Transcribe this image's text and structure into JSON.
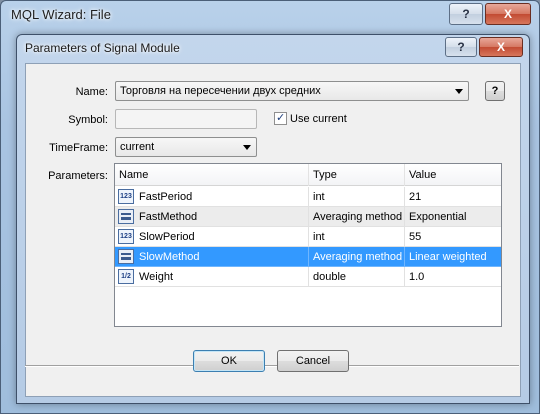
{
  "outer_window": {
    "title": "MQL Wizard: File",
    "help_label": "?",
    "close_label": "X"
  },
  "dialog": {
    "title": "Parameters of Signal Module",
    "help_label": "?",
    "close_label": "X",
    "name_label": "Name:",
    "name_value": "Торговля на пересечении двух средних",
    "name_help": "?",
    "symbol_label": "Symbol:",
    "symbol_value": "",
    "use_current_label": "Use current",
    "use_current_checked": true,
    "timeframe_label": "TimeFrame:",
    "timeframe_value": "current",
    "parameters_label": "Parameters:",
    "columns": [
      "Name",
      "Type",
      "Value"
    ],
    "rows": [
      {
        "name": "FastPeriod",
        "type": "int",
        "value": "21",
        "icon": "integer-param-icon",
        "icon_text": "123"
      },
      {
        "name": "FastMethod",
        "type": "Averaging method",
        "value": "Exponential",
        "icon": "enum-param-icon",
        "icon_text": ""
      },
      {
        "name": "SlowPeriod",
        "type": "int",
        "value": "55",
        "icon": "integer-param-icon",
        "icon_text": "123"
      },
      {
        "name": "SlowMethod",
        "type": "Averaging method",
        "value": "Linear weighted",
        "icon": "enum-param-icon",
        "icon_text": ""
      },
      {
        "name": "Weight",
        "type": "double",
        "value": "1.0",
        "icon": "double-param-icon",
        "icon_text": "1/2"
      }
    ],
    "selected_row": 3,
    "ok_label": "OK",
    "cancel_label": "Cancel"
  },
  "colors": {
    "selection": "#3399ff",
    "accent_title_bar": "#b5cbe5"
  }
}
